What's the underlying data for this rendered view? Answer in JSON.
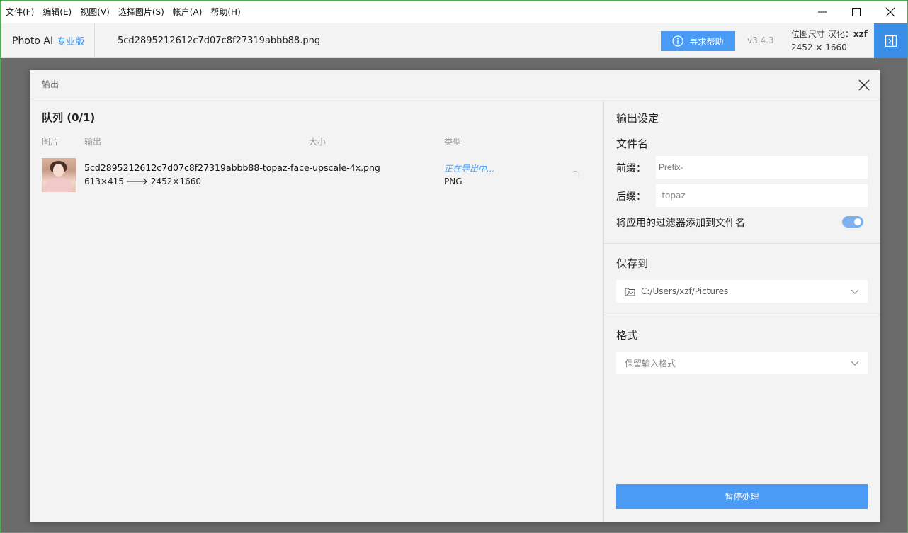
{
  "menu": {
    "items": [
      "文件(F)",
      "编辑(E)",
      "视图(V)",
      "选择图片(S)",
      "帐户(A)",
      "帮助(H)"
    ]
  },
  "header": {
    "app_name": "Photo AI",
    "edition": "专业版",
    "filename": "5cd2895212612c7d07c8f27319abbb88.png",
    "help_label": "寻求帮助",
    "version": "v3.4.3",
    "bitmap_label": "位图尺寸",
    "localization_label": "汉化：",
    "localization_author": "xzf",
    "bitmap_size": "2452 × 1660",
    "accent": "#3b8ee8"
  },
  "dialog": {
    "title": "输出"
  },
  "queue": {
    "title": "队列 (0/1)",
    "columns": [
      "图片",
      "输出",
      "大小",
      "类型"
    ],
    "items": [
      {
        "name": "5cd2895212612c7d07c8f27319abbb88-topaz-face-upscale-4x.png",
        "from_size": "613×415",
        "to_size": "2452×1660",
        "status": "正在导出中...",
        "type": "PNG"
      }
    ]
  },
  "settings": {
    "title": "输出设定",
    "filename_section": "文件名",
    "prefix_label": "前缀：",
    "prefix_placeholder": "Prefix-",
    "suffix_label": "后缀：",
    "suffix_value": "-topaz",
    "append_filters_label": "将应用的过滤器添加到文件名",
    "append_filters_enabled": true,
    "save_to_section": "保存到",
    "save_path": "C:/Users/xzf/Pictures",
    "format_section": "格式",
    "format_value": "保留输入格式",
    "pause_label": "暂停处理"
  }
}
